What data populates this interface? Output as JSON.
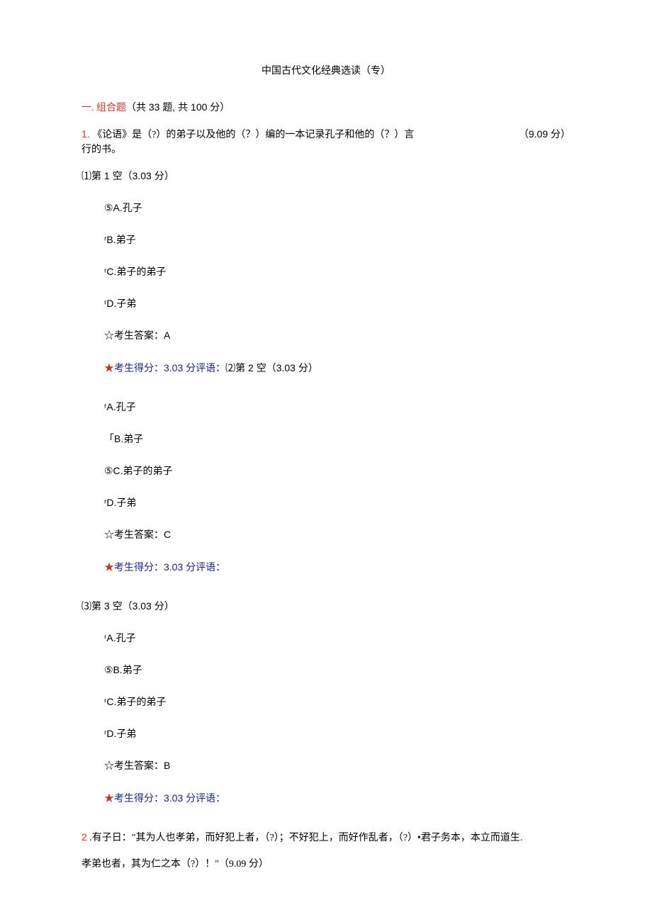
{
  "title": "中国古代文化经典选读（专）",
  "section": {
    "prefix": "一. 组合题",
    "info_left": "（共",
    "count": "33",
    "mid": "题, 共",
    "total": "100",
    "suffix": "分）"
  },
  "q1": {
    "num": "1.",
    "text_line1": "《论语》是（?）的弟子以及他的（？）编的一本记录孔子和他的（？）言",
    "text_line2": "行的书。",
    "score": "（9.09 分）",
    "blank1": {
      "header": "⑴第 1 空（3.03 分）",
      "optA": "⑤A.孔子",
      "optB": "ʳB.弟子",
      "optC": "ʳC.弟子的弟子",
      "optD": "ʳD.子弟",
      "answer_prefix": "☆考生答案：",
      "answer": "A",
      "score_star": "★",
      "score_label": "考生得分：",
      "score_val": "3.03 分",
      "comment_label": "评语：",
      "next": "⑵第 2 空（3.03 分）"
    },
    "blank2": {
      "optA": "ʳA.孔子",
      "optB": "「B.弟子",
      "optC": "⑤C.弟子的弟子",
      "optD": "ʳD.子弟",
      "answer_prefix": "☆考生答案：",
      "answer": "C",
      "score_star": "★",
      "score_label": "考生得分：",
      "score_val": "3.03 分",
      "comment_label": "评语："
    },
    "blank3": {
      "header": "⑶第 3 空（3.03 分）",
      "optA": "ʳA.孔子",
      "optB": "⑤B.弟子",
      "optC": "ʳC.弟子的弟子",
      "optD": "ʳD.子弟",
      "answer_prefix": "☆考生答案：",
      "answer": "B",
      "score_star": "★",
      "score_label": "考生得分：",
      "score_val": "3.03 分",
      "comment_label": "评语："
    }
  },
  "q2": {
    "num": "2",
    "text_line1": " .有子日：\"其为人也孝弟，而好犯上者，（?）；不好犯上，而好作乱者，（?）•君子务本，本立而道生.",
    "text_line2": "孝弟也者，其为仁之本（?）！\"（9.09 分）"
  }
}
